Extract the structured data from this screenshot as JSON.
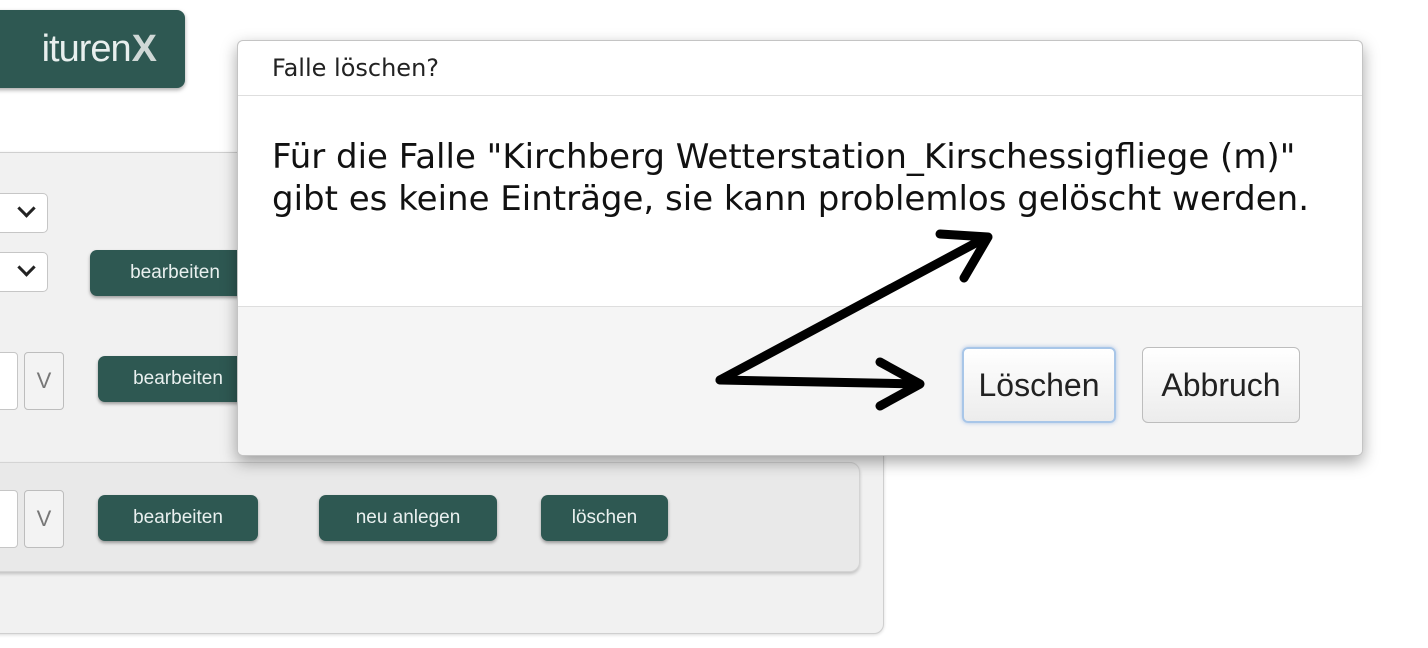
{
  "logo": {
    "text": "ituren",
    "mark": "X"
  },
  "background": {
    "rows": [
      {
        "edit_label": "bearbeiten"
      },
      {
        "edit_label": "bearbeiten"
      },
      {
        "edit_label": "bearbeiten",
        "new_label": "neu anlegen",
        "delete_label": "löschen"
      }
    ],
    "v_label": "V"
  },
  "dialog": {
    "title": "Falle löschen?",
    "message": "Für die Falle \"Kirchberg Wetterstation_Kirschessigfliege (m)\" gibt es keine Einträge, sie kann problemlos gelöscht werden.",
    "delete_button": "Löschen",
    "cancel_button": "Abbruch"
  },
  "annotation": {
    "icon": "hand-drawn-arrows-icon",
    "color": "#000000"
  }
}
